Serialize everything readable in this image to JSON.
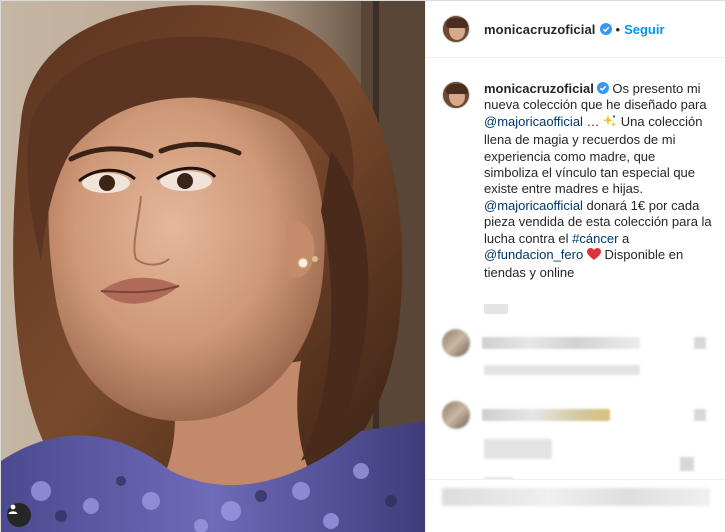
{
  "post": {
    "username": "monicacruzoficial",
    "follow_label": "Seguir",
    "separator": "•"
  },
  "caption": {
    "username": "monicacruzoficial",
    "part1": " Os presento mi nueva colección que he diseñado para ",
    "mention1": "@majoricaofficial",
    "part2": " … ",
    "part3": " Una colección llena de magia y recuerdos de mi experiencia como madre, que simboliza el vínculo tan especial que existe entre madres e hijas. ",
    "mention2": "@majoricaofficial",
    "part4": " donará 1€ por cada pieza vendida de esta colección para la lucha contra el ",
    "hashtag": "#cáncer",
    "part5": " a ",
    "mention3": "@fundacion_fero",
    "part6": " Disponible en tiendas y online"
  },
  "colors": {
    "accent": "#0095f6",
    "link": "#00376b",
    "text": "#262626",
    "border": "#efefef",
    "heart": "#ed4956",
    "sparkle": "#f5c518"
  },
  "icons": {
    "verified": "verified-badge-icon",
    "sparkle": "sparkles-icon",
    "heart": "red-heart-icon",
    "user_tag": "user-tag-icon"
  }
}
